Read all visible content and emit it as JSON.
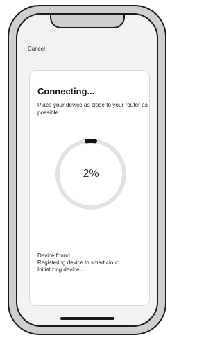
{
  "header": {
    "cancel_label": "Cancel"
  },
  "card": {
    "title": "Connecting",
    "title_dots": "...",
    "subtitle": "Place your device as close to your router as possible"
  },
  "progress": {
    "percent": 2,
    "label": "2%",
    "track_color": "#e2e2e2",
    "fill_color": "#111111"
  },
  "status": {
    "lines": [
      "Device found",
      "Registering device to smart cloud",
      "Initializing device"
    ],
    "last_suffix": "..."
  }
}
